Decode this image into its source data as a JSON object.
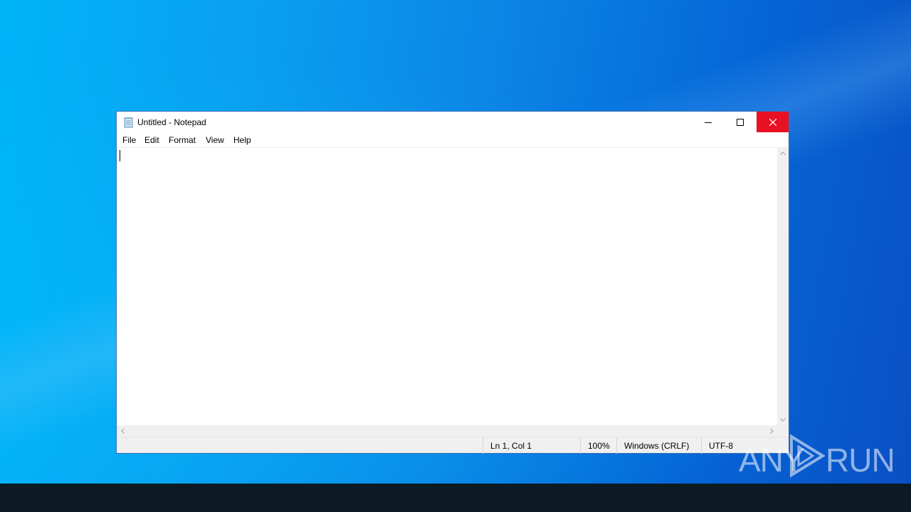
{
  "desktop": {
    "watermark": {
      "left": "ANY",
      "right": "RUN"
    }
  },
  "window": {
    "title": "Untitled - Notepad",
    "controls": {
      "minimize": "minimize-icon",
      "maximize": "maximize-icon",
      "close": "close-icon"
    },
    "close_hover_color": "#e81123"
  },
  "menu": {
    "items": [
      {
        "label": "File"
      },
      {
        "label": "Edit"
      },
      {
        "label": "Format"
      },
      {
        "label": "View"
      },
      {
        "label": "Help"
      }
    ]
  },
  "editor": {
    "content": ""
  },
  "statusbar": {
    "position": "Ln 1, Col 1",
    "zoom": "100%",
    "line_ending": "Windows (CRLF)",
    "encoding": "UTF-8"
  }
}
